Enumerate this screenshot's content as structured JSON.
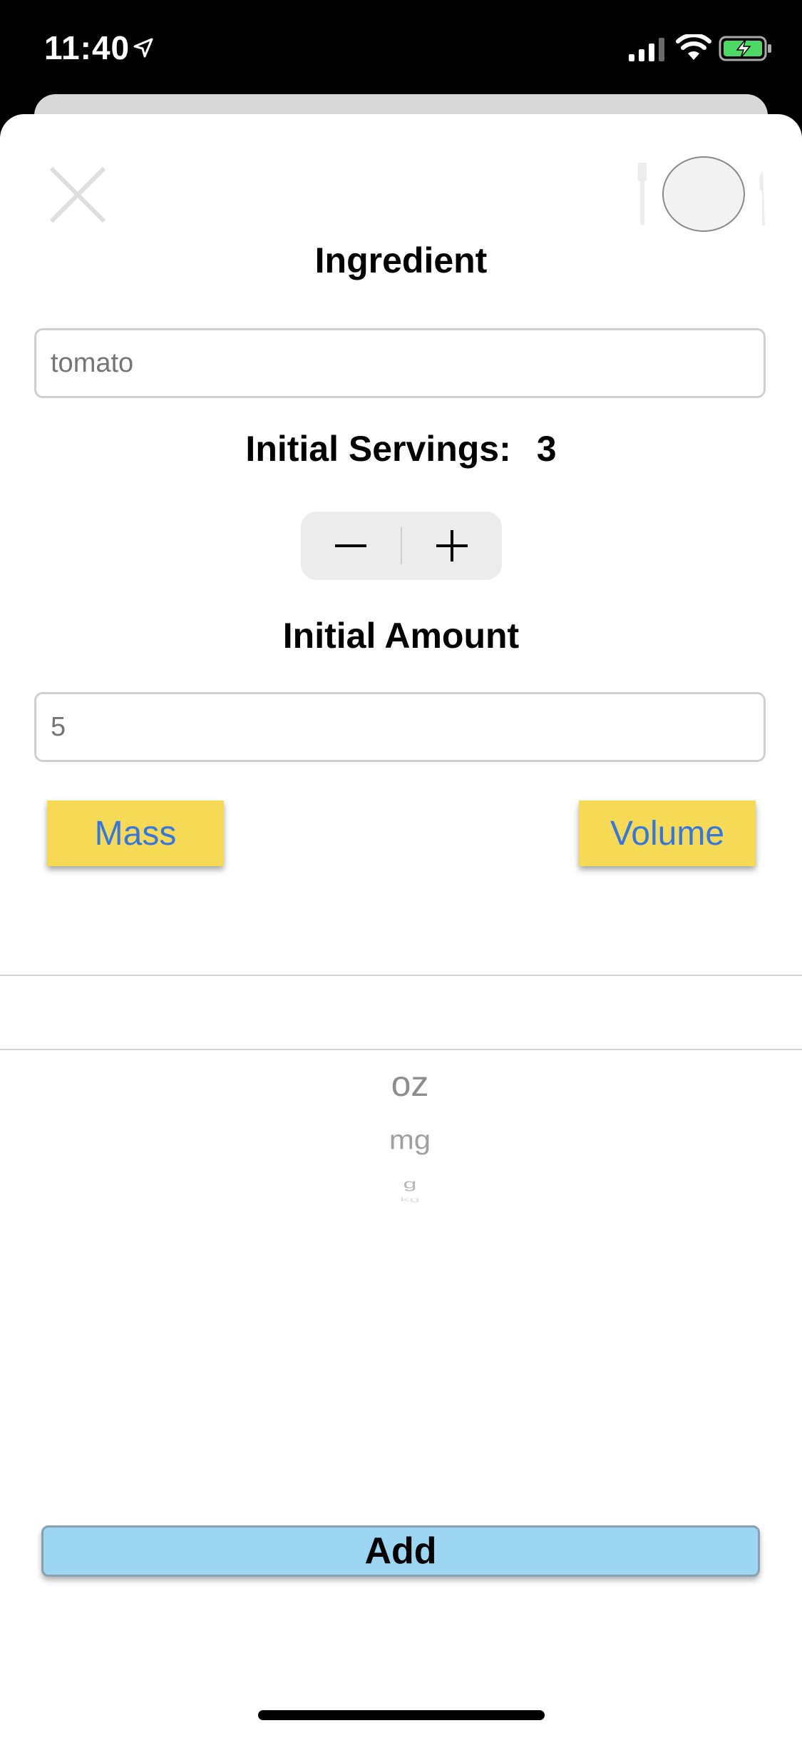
{
  "status_bar": {
    "time": "11:40"
  },
  "sheet": {
    "ingredient_title": "Ingredient",
    "ingredient_field": {
      "value": "",
      "placeholder": "tomato"
    },
    "servings_label": "Initial Servings:",
    "servings_value": "3",
    "stepper": {
      "minus": "−",
      "plus": "+"
    },
    "amount_title": "Initial Amount",
    "amount_field": {
      "value": "",
      "placeholder": "5"
    },
    "mass_button": "Mass",
    "volume_button": "Volume",
    "unit_picker": {
      "selected": "",
      "items": [
        "oz",
        "mg",
        "g",
        "kg"
      ]
    },
    "add_button": "Add"
  },
  "colors": {
    "accent_yellow": "#f6d954",
    "link_blue": "#3477e0",
    "add_blue": "#9cd6f2"
  }
}
